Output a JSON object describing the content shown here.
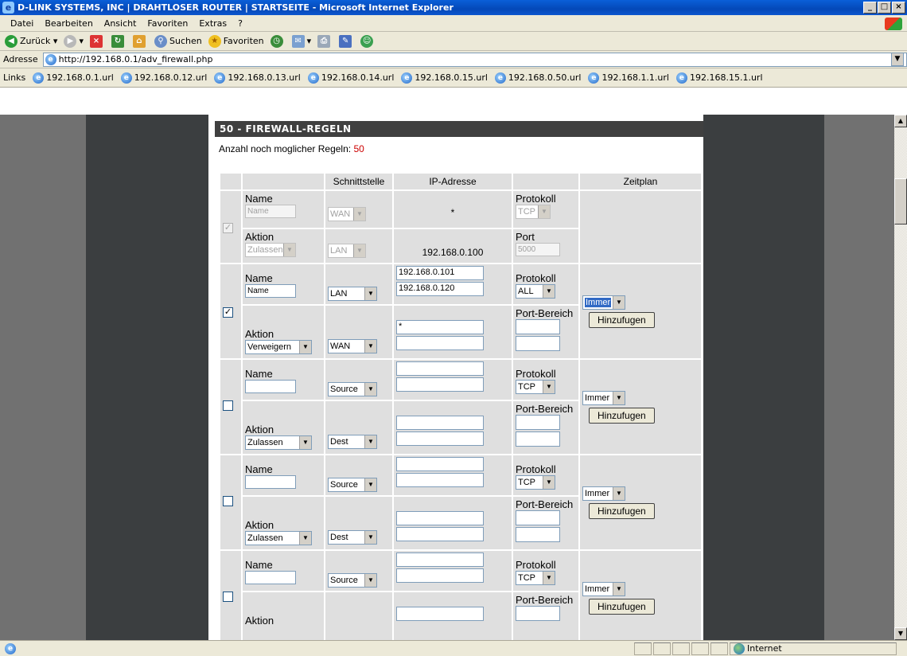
{
  "window": {
    "title": "D-LINK SYSTEMS, INC | DRAHTLOSER ROUTER | STARTSEITE - Microsoft Internet Explorer"
  },
  "menu": [
    "Datei",
    "Bearbeiten",
    "Ansicht",
    "Favoriten",
    "Extras",
    "?"
  ],
  "toolbar": {
    "back": "Zurück",
    "search": "Suchen",
    "favorites": "Favoriten"
  },
  "address": {
    "label": "Adresse",
    "url": "http://192.168.0.1/adv_firewall.php"
  },
  "links": {
    "label": "Links",
    "items": [
      "192.168.0.1.url",
      "192.168.0.12.url",
      "192.168.0.13.url",
      "192.168.0.14.url",
      "192.168.0.15.url",
      "192.168.0.50.url",
      "192.168.1.1.url",
      "192.168.15.1.url"
    ]
  },
  "panel": {
    "heading": "50 - FIREWALL-REGELN",
    "remaining_label": "Anzahl noch moglicher Regeln:",
    "remaining_count": "50"
  },
  "table": {
    "headers": {
      "blank1": "",
      "blank2": "",
      "interface": "Schnittstelle",
      "ip": "IP-Adresse",
      "blank3": "",
      "schedule": "Zeitplan"
    },
    "labels": {
      "name": "Name",
      "action": "Aktion",
      "protocol": "Protokoll",
      "port": "Port",
      "port_range": "Port-Bereich",
      "add": "Hinzufugen"
    },
    "rule0": {
      "name_placeholder": "Name",
      "iface_src": "WAN",
      "ip_src": "*",
      "protocol": "TCP",
      "action": "Zulassen",
      "iface_dst": "LAN",
      "ip_dst": "192.168.0.100",
      "port": "5000"
    },
    "rule1": {
      "name": "Name",
      "iface_src": "LAN",
      "ip_src_start": "192.168.0.101",
      "ip_src_end": "192.168.0.120",
      "protocol": "ALL",
      "schedule": "Immer",
      "action": "Verweigern",
      "iface_dst": "WAN",
      "ip_dst_start": "*"
    },
    "rule2": {
      "iface_src": "Source",
      "protocol": "TCP",
      "schedule": "Immer",
      "action": "Zulassen",
      "iface_dst": "Dest"
    },
    "rule3": {
      "iface_src": "Source",
      "protocol": "TCP",
      "schedule": "Immer",
      "action": "Zulassen",
      "iface_dst": "Dest"
    },
    "rule4": {
      "iface_src": "Source",
      "protocol": "TCP",
      "schedule": "Immer"
    }
  },
  "status": {
    "zone": "Internet"
  }
}
